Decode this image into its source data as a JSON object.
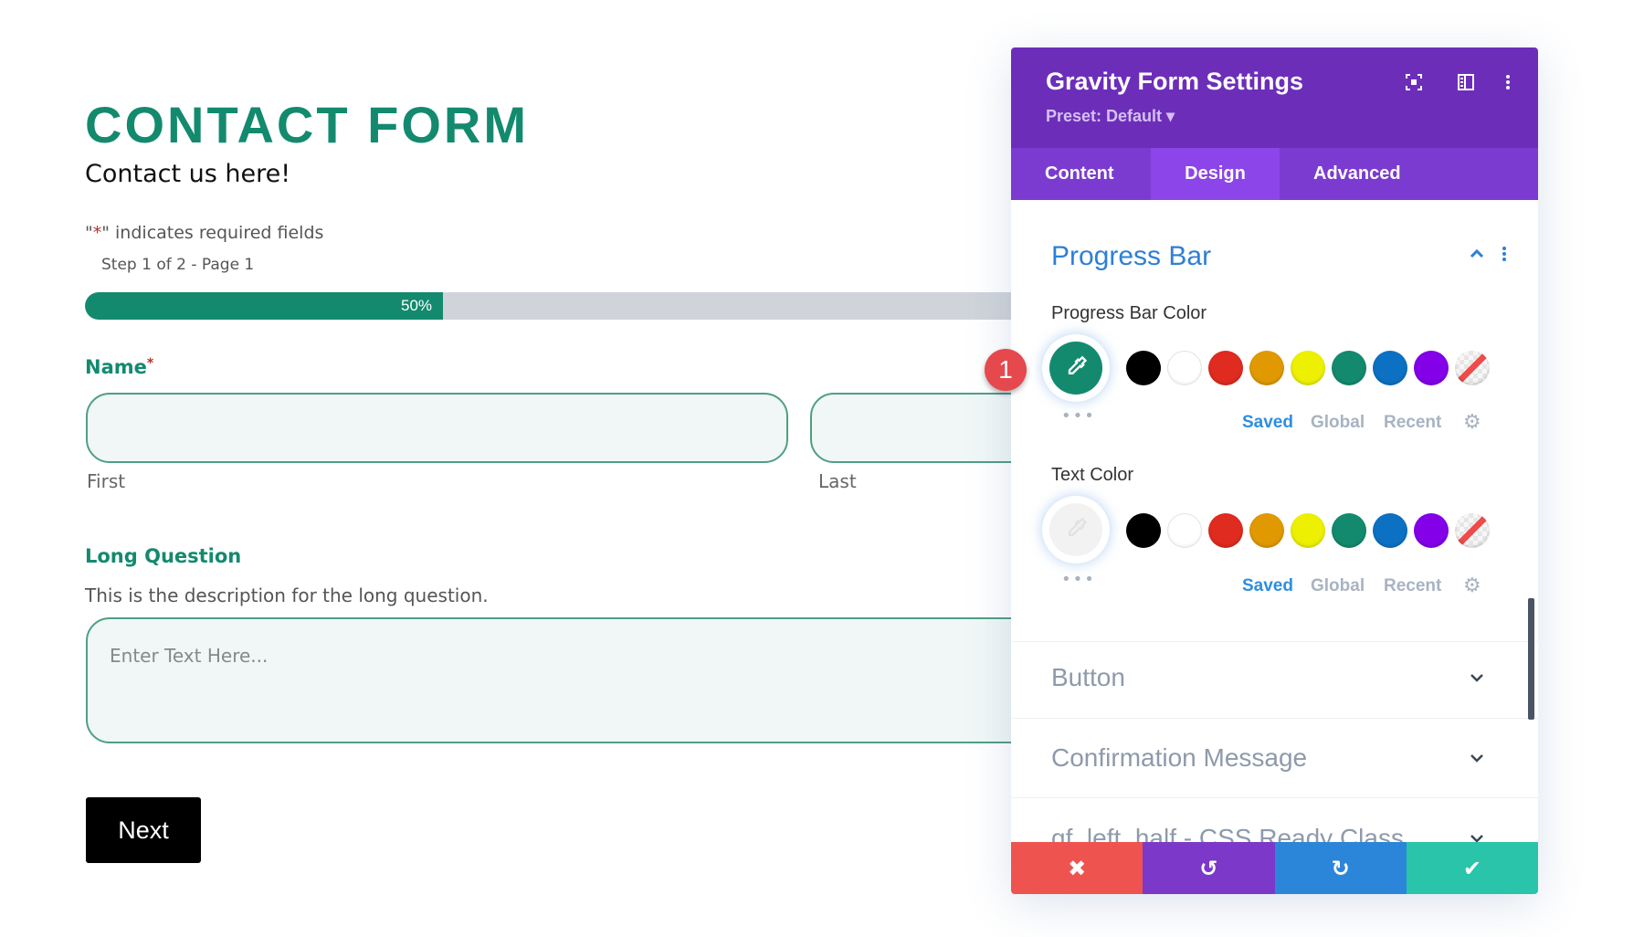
{
  "page": {
    "title": "CONTACT FORM",
    "subtitle": "Contact us here!",
    "required_note_prefix": "\"",
    "required_note_star": "*",
    "required_note_suffix": "\" indicates required fields",
    "step_text": "Step 1 of 2 - Page 1",
    "progress": {
      "percent": 50,
      "label": "50%"
    },
    "name_field": {
      "label": "Name",
      "required_mark": "*",
      "first_label": "First",
      "last_label": "Last",
      "first_value": "",
      "last_value": ""
    },
    "long_question": {
      "label": "Long Question",
      "description": "This is the description for the long question.",
      "placeholder": "Enter Text Here...",
      "value": ""
    },
    "next_button": "Next"
  },
  "panel": {
    "title": "Gravity Form Settings",
    "preset": "Preset: Default ▾",
    "header_icons": [
      "focus-icon",
      "split-view-icon",
      "kebab-menu-icon"
    ],
    "tabs": [
      {
        "label": "Content",
        "active": false
      },
      {
        "label": "Design",
        "active": true
      },
      {
        "label": "Advanced",
        "active": false
      }
    ],
    "progress_section": {
      "title": "Progress Bar",
      "bar_color": {
        "label": "Progress Bar Color",
        "value": "#138a6e"
      },
      "text_color": {
        "label": "Text Color",
        "value": "#ffffff"
      }
    },
    "swatches": [
      "#000000",
      "#ffffff",
      "#e02b20",
      "#e09900",
      "#edf000",
      "#138a6e",
      "#0c71c3",
      "#8300e9",
      "none"
    ],
    "palette_tabs": [
      "Saved",
      "Global",
      "Recent"
    ],
    "collapsed_sections": [
      "Button",
      "Confirmation Message",
      "gf_left_half - CSS Ready Class"
    ],
    "footer": [
      {
        "name": "cancel",
        "glyph": "✖",
        "color": "#ef5350"
      },
      {
        "name": "undo",
        "glyph": "↺",
        "color": "#7b38c9"
      },
      {
        "name": "redo",
        "glyph": "↻",
        "color": "#2b86d9"
      },
      {
        "name": "save",
        "glyph": "✔",
        "color": "#29c4a9"
      }
    ]
  },
  "annotation": {
    "badge": "1"
  }
}
